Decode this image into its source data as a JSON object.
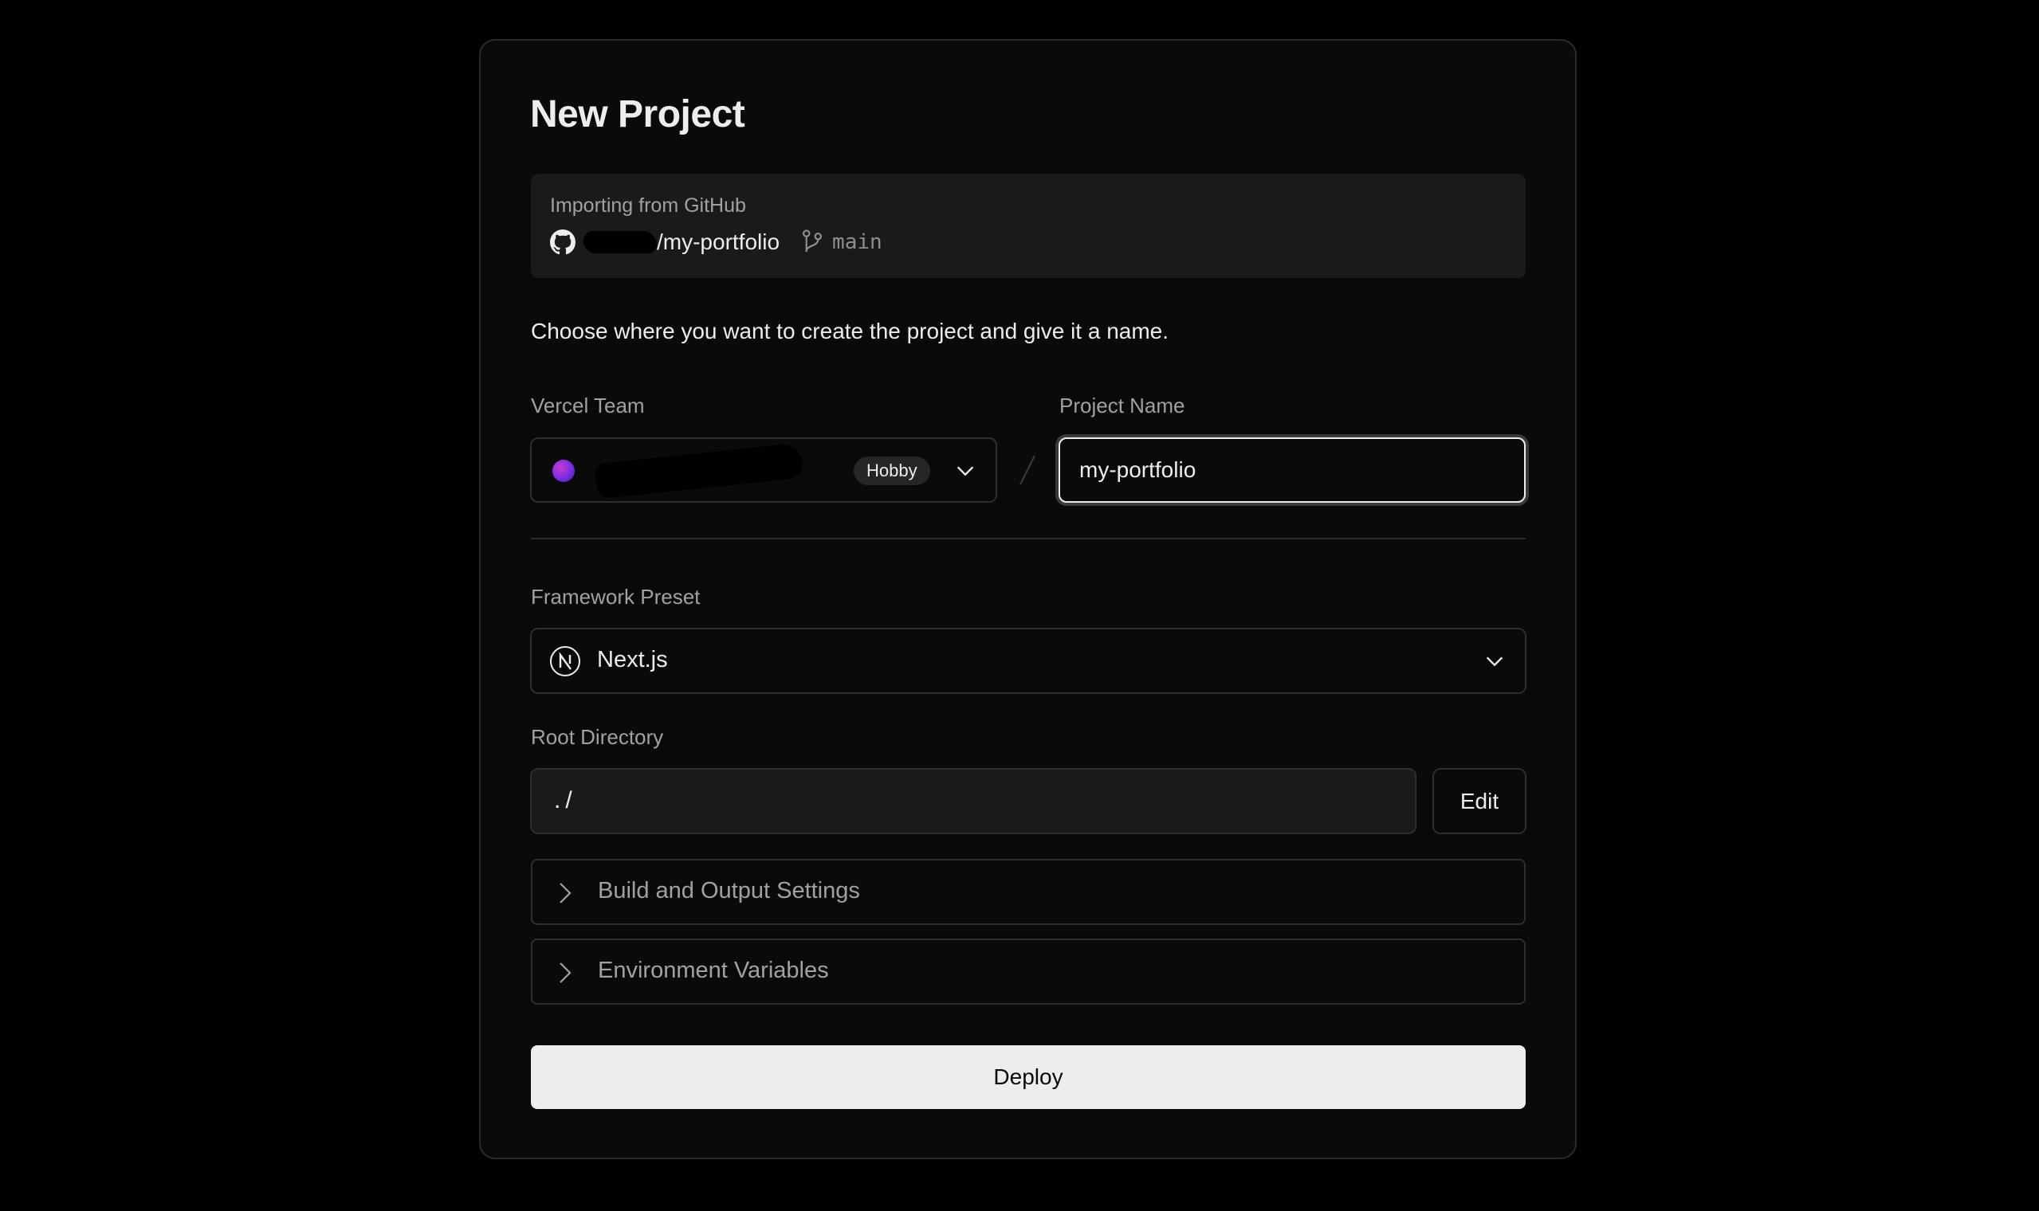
{
  "page": {
    "title": "New Project"
  },
  "import": {
    "label": "Importing from GitHub",
    "repo_suffix": "/my-portfolio",
    "branch": "main"
  },
  "instructions": "Choose where you want to create the project and give it a name.",
  "team": {
    "label": "Vercel Team",
    "plan_badge": "Hobby"
  },
  "project_name": {
    "label": "Project Name",
    "value": "my-portfolio"
  },
  "framework": {
    "label": "Framework Preset",
    "value": "Next.js"
  },
  "root_directory": {
    "label": "Root Directory",
    "value": "./",
    "edit_label": "Edit"
  },
  "sections": [
    {
      "label": "Build and Output Settings"
    },
    {
      "label": "Environment Variables"
    }
  ],
  "deploy_label": "Deploy",
  "icons": {
    "repo_source": "github-icon",
    "branch": "git-branch-icon",
    "framework": "nextjs-icon",
    "dropdown": "chevron-down-icon",
    "expand": "chevron-right-icon"
  },
  "colors": {
    "background": "#000000",
    "card": "#0a0a0a",
    "muted_text": "#a1a1a1",
    "primary_button": "#ededed"
  }
}
